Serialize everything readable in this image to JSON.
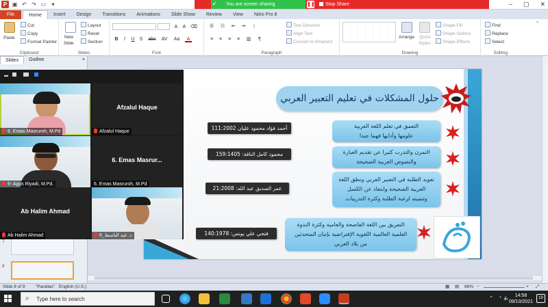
{
  "titlebar": {
    "share_status": "You are screen sharing",
    "stop_share": "Stop Share"
  },
  "tabs": [
    "File",
    "Home",
    "Insert",
    "Design",
    "Transitions",
    "Animations",
    "Slide Show",
    "Review",
    "View",
    "Nitro Pro 8"
  ],
  "ribbon": {
    "clipboard": {
      "paste": "Paste",
      "cut": "Cut",
      "copy": "Copy",
      "format_painter": "Format Painter",
      "name": "Clipboard"
    },
    "slides": {
      "new_slide": "New",
      "new_slide2": "Slide",
      "layout": "Layout",
      "reset": "Reset",
      "section": "Section",
      "name": "Slides"
    },
    "font": {
      "name": "Font",
      "bold": "B",
      "italic": "I",
      "underline": "U",
      "shadow": "S",
      "strike": "abc",
      "spacing": "AV",
      "case": "Aa",
      "color": "A"
    },
    "paragraph": {
      "text_direction": "Text Direction",
      "align_text": "Align Text",
      "convert": "Convert to SmartArt",
      "name": "Paragraph"
    },
    "drawing": {
      "arrange": "Arrange",
      "quick_styles": "Quick",
      "quick_styles2": "Styles",
      "shape_fill": "Shape Fill",
      "shape_outline": "Shape Outline",
      "shape_effects": "Shape Effects",
      "name": "Drawing"
    },
    "editing": {
      "find": "Find",
      "replace": "Replace",
      "select": "Select",
      "name": "Editing"
    }
  },
  "panel": {
    "tab_slides": "Slides",
    "tab_outline": "Outline",
    "close": "×",
    "thumb_numbers": [
      "7",
      "8"
    ]
  },
  "zoom": {
    "tiles": [
      {
        "name": "6. Emas Masruroh, M.Pd",
        "type": "video"
      },
      {
        "name": "Afzalul Haque",
        "center": "Afzalul Haque",
        "type": "name"
      },
      {
        "name": "6- Agus Riyadi, M.Pd.",
        "type": "video"
      },
      {
        "name": "6. Emas Masruroh, M.Pd",
        "center": "6. Emas Masrur...",
        "type": "name"
      },
      {
        "name": "Ab Halim Ahmad",
        "center": "Ab Halim Ahmad",
        "type": "name"
      },
      {
        "name": "د. عبد الباسط_6",
        "type": "video"
      }
    ]
  },
  "slide": {
    "title": "حلول المشكلات في تعليم التعبير العربي",
    "rows": [
      {
        "source": "أحمد فؤاد محمود عليان 111:2002",
        "text1": "التعمق في تعلم اللغة العربية",
        "text2": "علومها وأدابها فهما جيدا"
      },
      {
        "source": "محمود كامل الناقة: 159:1405",
        "text1": "التمرن والتدرب كثيرا عن تقديم العبارة",
        "text2": "والنصوص العربية الصحيحة"
      },
      {
        "source": "عمر الصديق عبد الله: 21:2008",
        "text1": "تعويد الطلبة في التعبير العربي ونطق اللغة",
        "text2": "العربية الصحيحة وابتعاد عن الكسل",
        "text3": "وتنميته لرغبة الطلبة وكثرة التدريبات"
      },
      {
        "source": "فتحي علي يونس: 140:1978",
        "text1": "التفريق بين اللغة الفاصحة والعامية وكثرة الندوة",
        "text2": "العلمية العالمية اللغوية الإفتراضية بإتيان المتحدثين",
        "text3": "من بلاد العربي"
      }
    ]
  },
  "status": {
    "slide": "Slide 8 of 9",
    "theme": "\"Parallax\"",
    "lang": "English (U.S.)",
    "zoom": "66%"
  },
  "taskbar": {
    "search_placeholder": "Type here to search",
    "time": "14:58",
    "date": "09/10/2021",
    "notifications": "19"
  },
  "colors": {
    "accent_blue": "#7cc4ea",
    "dark_pill": "#2d2d2d",
    "share_red": "#e52a2a",
    "share_green": "#32c14b",
    "file_tab": "#d04525"
  }
}
